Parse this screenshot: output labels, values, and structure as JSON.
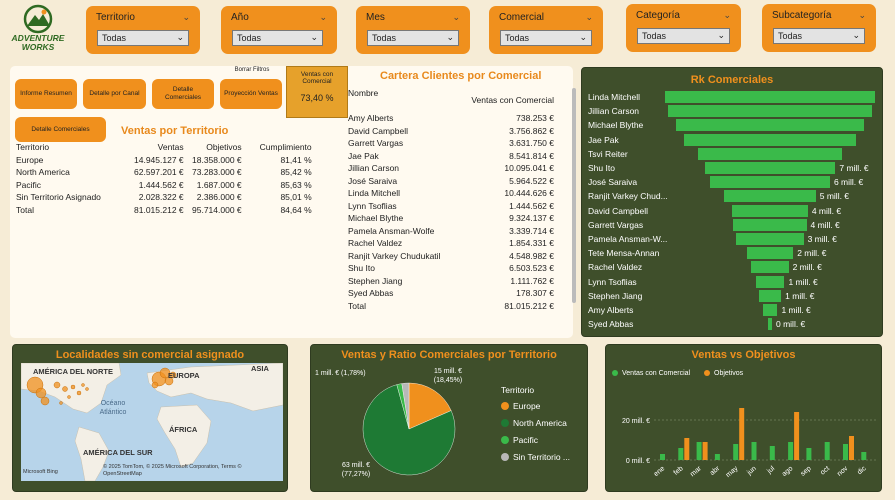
{
  "logo": {
    "line1": "ADVENTURE",
    "line2": "WORKS"
  },
  "slicers": [
    {
      "label": "Territorio",
      "value": "Todas"
    },
    {
      "label": "Año",
      "value": "Todas"
    },
    {
      "label": "Mes",
      "value": "Todas"
    },
    {
      "label": "Comercial",
      "value": "Todas"
    },
    {
      "label": "Categoría",
      "value": "Todas"
    },
    {
      "label": "Subcategoría",
      "value": "Todas"
    }
  ],
  "nav": {
    "informe_resumen": "Informe Resumen",
    "detalle_canal": "Detalle por Canal",
    "detalle_comerciales": "Detalle Comerciales",
    "proyeccion_ventas": "Proyección Ventas",
    "borrar_filtros": "Borrar Filtros",
    "detalle_comerciales_2": "Detalle Comerciales"
  },
  "kpi": {
    "label": "Ventas con Comercial",
    "value": "73,40 %"
  },
  "ventas_territorio": {
    "title": "Ventas por Territorio",
    "headers": [
      "Territorio",
      "Ventas",
      "Objetivos",
      "Cumplimiento"
    ],
    "rows": [
      [
        "Europe",
        "14.945.127 €",
        "18.358.000 €",
        "81,41 %"
      ],
      [
        "North America",
        "62.597.201 €",
        "73.283.000 €",
        "85,42 %"
      ],
      [
        "Pacific",
        "1.444.562 €",
        "1.687.000 €",
        "85,63 %"
      ],
      [
        "Sin Territorio Asignado",
        "2.028.322 €",
        "2.386.000 €",
        "85,01 %"
      ],
      [
        "Total",
        "81.015.212 €",
        "95.714.000 €",
        "84,64 %"
      ]
    ]
  },
  "cartera": {
    "title": "Cartera Clientes por Comercial",
    "headers": [
      "Nombre",
      "Ventas con Comercial"
    ],
    "rows": [
      [
        "Amy Alberts",
        "738.253 €"
      ],
      [
        "David Campbell",
        "3.756.862 €"
      ],
      [
        "Garrett Vargas",
        "3.631.750 €"
      ],
      [
        "Jae Pak",
        "8.541.814 €"
      ],
      [
        "Jillian Carson",
        "10.095.041 €"
      ],
      [
        "José Saraiva",
        "5.964.522 €"
      ],
      [
        "Linda Mitchell",
        "10.444.626 €"
      ],
      [
        "Lynn Tsoflias",
        "1.444.562 €"
      ],
      [
        "Michael Blythe",
        "9.324.137 €"
      ],
      [
        "Pamela Ansman-Wolfe",
        "3.339.714 €"
      ],
      [
        "Rachel Valdez",
        "1.854.331 €"
      ],
      [
        "Ranjit Varkey Chudukatil",
        "4.548.982 €"
      ],
      [
        "Shu Ito",
        "6.503.523 €"
      ],
      [
        "Stephen Jiang",
        "1.111.762 €"
      ],
      [
        "Syed Abbas",
        "178.307 €"
      ],
      [
        "Total",
        "81.015.212 €"
      ]
    ]
  },
  "ranking": {
    "title": "Rk Comerciales",
    "items": [
      {
        "name": "Linda Mitchell",
        "value": 10.44,
        "label": ""
      },
      {
        "name": "Jillian Carson",
        "value": 10.1,
        "label": ""
      },
      {
        "name": "Michael Blythe",
        "value": 9.32,
        "label": ""
      },
      {
        "name": "Jae Pak",
        "value": 8.54,
        "label": ""
      },
      {
        "name": "Tsvi Reiter",
        "value": 7.17,
        "label": ""
      },
      {
        "name": "Shu Ito",
        "value": 6.5,
        "label": "7 mill. €"
      },
      {
        "name": "José Saraiva",
        "value": 5.96,
        "label": "6 mill. €"
      },
      {
        "name": "Ranjit Varkey Chud...",
        "value": 4.55,
        "label": "5 mill. €"
      },
      {
        "name": "David Campbell",
        "value": 3.76,
        "label": "4 mill. €"
      },
      {
        "name": "Garrett Vargas",
        "value": 3.63,
        "label": "4 mill. €"
      },
      {
        "name": "Pamela Ansman-W...",
        "value": 3.34,
        "label": "3 mill. €"
      },
      {
        "name": "Tete Mensa-Annan",
        "value": 2.31,
        "label": "2 mill. €"
      },
      {
        "name": "Rachel Valdez",
        "value": 1.85,
        "label": "2 mill. €"
      },
      {
        "name": "Lynn Tsoflias",
        "value": 1.44,
        "label": "1 mill. €"
      },
      {
        "name": "Stephen Jiang",
        "value": 1.11,
        "label": "1 mill. €"
      },
      {
        "name": "Amy Alberts",
        "value": 0.74,
        "label": "1 mill. €"
      },
      {
        "name": "Syed Abbas",
        "value": 0.18,
        "label": "0 mill. €"
      }
    ]
  },
  "map": {
    "title": "Localidades sin comercial asignado",
    "labels": {
      "na": "AMÉRICA DEL NORTE",
      "eu": "EUROPA",
      "asia": "ASIA",
      "ocean": "Océano Atlántico",
      "africa": "ÁFRICA",
      "sa": "AMÉRICA DEL SUR"
    },
    "attribution": "© 2025 TomTom, © 2025 Microsoft Corporation, Terms © OpenStreetMap",
    "bing": "Microsoft Bing"
  },
  "pie": {
    "title": "Ventas y Ratio Comerciales por Territorio",
    "legend_title": "Territorio",
    "slices": [
      {
        "name": "Europe",
        "value": 18.45,
        "color": "#f0901d",
        "label": "15 mill. € (18,45%)"
      },
      {
        "name": "North America",
        "value": 77.27,
        "color": "#1e7a34",
        "label": "63 mill. € (77,27%)"
      },
      {
        "name": "Pacific",
        "value": 1.78,
        "color": "#3aba4a",
        "label": "1 mill. € (1,78%)"
      },
      {
        "name": "Sin Territorio ...",
        "value": 2.5,
        "color": "#b8b8b8",
        "label": ""
      }
    ]
  },
  "chart_data": {
    "type": "bar",
    "title": "Ventas vs Objetivos",
    "categories": [
      "ene",
      "feb",
      "mar",
      "abr",
      "may",
      "jun",
      "jul",
      "ago",
      "sep",
      "oct",
      "nov",
      "dic"
    ],
    "series": [
      {
        "name": "Ventas con Comercial",
        "color": "#3aba4a",
        "values": [
          3,
          6,
          9,
          3,
          8,
          9,
          7,
          9,
          6,
          9,
          8,
          4
        ]
      },
      {
        "name": "Objetivos",
        "color": "#f0901d",
        "values": [
          0,
          11,
          9,
          0,
          26,
          0,
          0,
          24,
          0,
          0,
          12,
          0
        ]
      }
    ],
    "yticks": [
      "0 mill. €",
      "20 mill. €"
    ],
    "ylim": [
      0,
      30
    ]
  }
}
